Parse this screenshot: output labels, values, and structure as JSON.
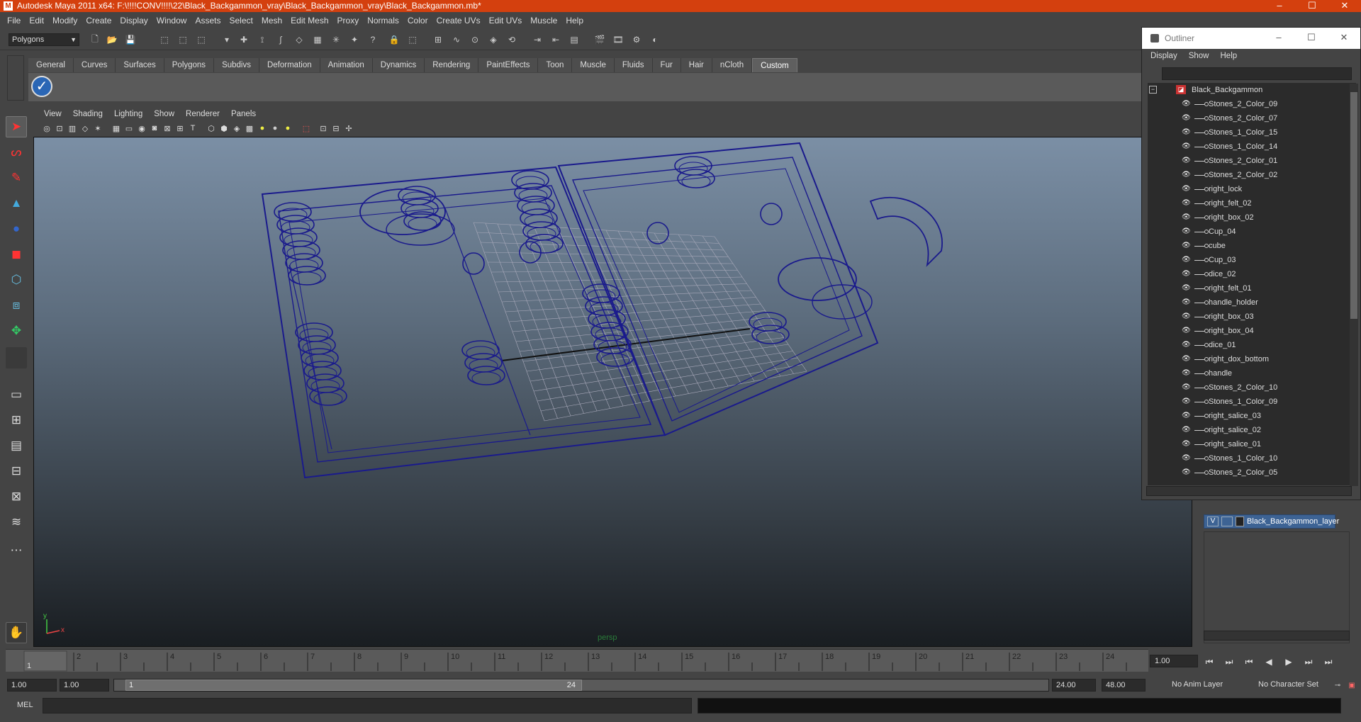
{
  "window": {
    "title": "Autodesk Maya 2011 x64: F:\\!!!!CONV!!!!\\22\\Black_Backgammon_vray\\Black_Backgammon_vray\\Black_Backgammon.mb*",
    "minimize": "–",
    "maximize": "☐",
    "close": "✕"
  },
  "menubar": [
    "File",
    "Edit",
    "Modify",
    "Create",
    "Display",
    "Window",
    "Assets",
    "Select",
    "Mesh",
    "Edit Mesh",
    "Proxy",
    "Normals",
    "Color",
    "Create UVs",
    "Edit UVs",
    "Muscle",
    "Help"
  ],
  "statusline": {
    "mode": "Polygons"
  },
  "shelf": {
    "tabs": [
      "General",
      "Curves",
      "Surfaces",
      "Polygons",
      "Subdivs",
      "Deformation",
      "Animation",
      "Dynamics",
      "Rendering",
      "PaintEffects",
      "Toon",
      "Muscle",
      "Fluids",
      "Fur",
      "Hair",
      "nCloth",
      "Custom"
    ],
    "active": "Custom"
  },
  "viewport": {
    "menu": [
      "View",
      "Shading",
      "Lighting",
      "Show",
      "Renderer",
      "Panels"
    ],
    "camera": "persp",
    "wire_color": "#1a1a8c",
    "axis": {
      "x": "x",
      "y": "y"
    }
  },
  "outliner": {
    "title": "Outliner",
    "menu": [
      "Display",
      "Show",
      "Help"
    ],
    "root": "Black_Backgammon",
    "items": [
      "Stones_2_Color_09",
      "Stones_2_Color_07",
      "Stones_1_Color_15",
      "Stones_1_Color_14",
      "Stones_2_Color_01",
      "Stones_2_Color_02",
      "right_lock",
      "right_felt_02",
      "right_box_02",
      "Cup_04",
      "cube",
      "Cup_03",
      "dice_02",
      "right_felt_01",
      "handle_holder",
      "right_box_03",
      "right_box_04",
      "dice_01",
      "right_dox_bottom",
      "handle",
      "Stones_2_Color_10",
      "Stones_1_Color_09",
      "right_salice_03",
      "right_salice_02",
      "right_salice_01",
      "Stones_1_Color_10",
      "Stones_2_Color_05"
    ]
  },
  "layers": {
    "visible_flag": "V",
    "layer_name": "Black_Backgammon_layer"
  },
  "timeline": {
    "ticks": [
      "1",
      "2",
      "3",
      "4",
      "5",
      "6",
      "7",
      "8",
      "9",
      "10",
      "11",
      "12",
      "13",
      "14",
      "15",
      "16",
      "17",
      "18",
      "19",
      "20",
      "21",
      "22",
      "23",
      "24"
    ],
    "current_frame": "1.00",
    "playhead": "1"
  },
  "playback": {
    "buttons": [
      "⏮",
      "⏭",
      "⏮",
      "◀",
      "▶",
      "⏭",
      "⏭"
    ]
  },
  "range": {
    "start": "1.00",
    "playback_start": "1.00",
    "slider_start": "1",
    "slider_end": "24",
    "playback_end": "24.00",
    "end": "48.00",
    "anim_layer": "No Anim Layer",
    "char_set": "No Character Set"
  },
  "cmdline": {
    "label": "MEL"
  }
}
